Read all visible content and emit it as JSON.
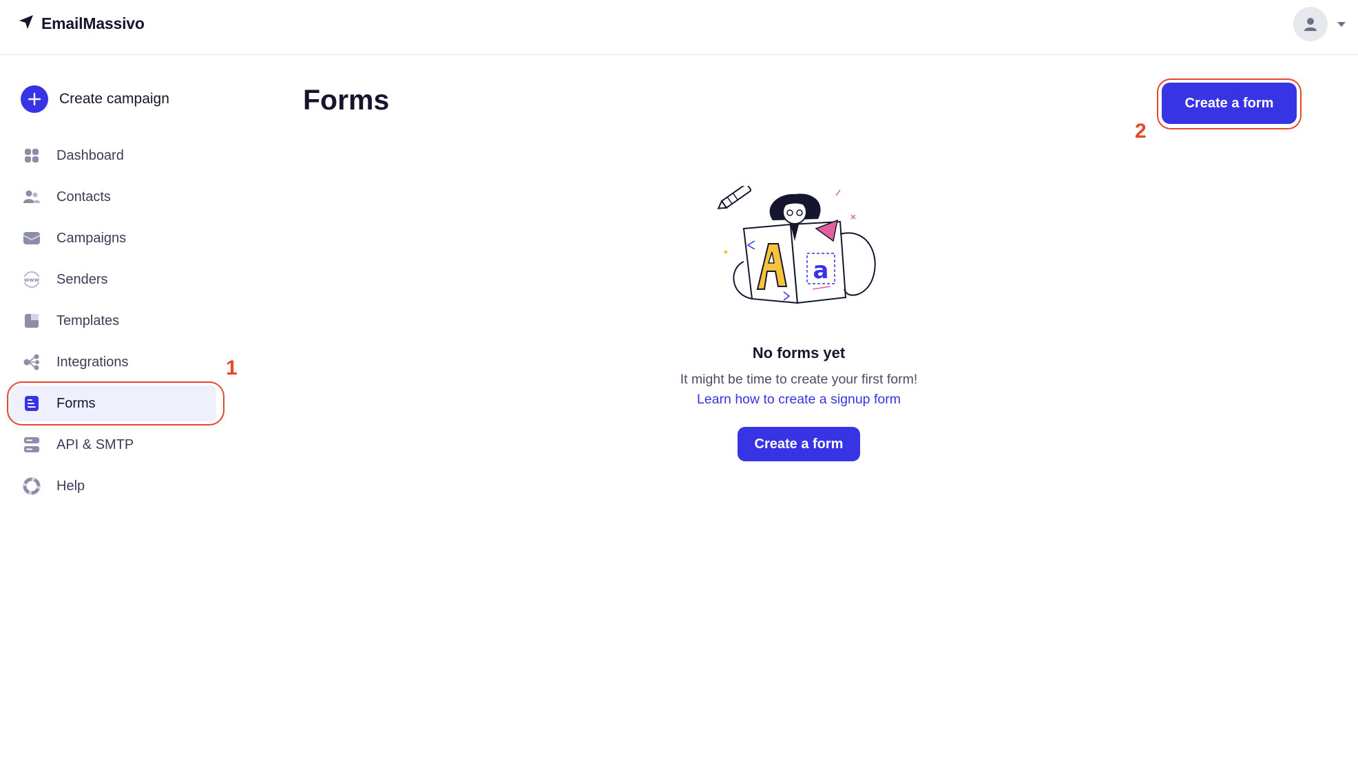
{
  "brand": {
    "name": "EmailMassivo",
    "icon": "paper-plane-icon"
  },
  "account": {
    "avatar_icon": "user-icon",
    "menu_icon": "caret-down-icon"
  },
  "sidebar": {
    "create_campaign": "Create campaign",
    "items": [
      {
        "label": "Dashboard",
        "icon": "dashboard-icon"
      },
      {
        "label": "Contacts",
        "icon": "contacts-icon"
      },
      {
        "label": "Campaigns",
        "icon": "campaigns-icon"
      },
      {
        "label": "Senders",
        "icon": "www-icon"
      },
      {
        "label": "Templates",
        "icon": "templates-icon"
      },
      {
        "label": "Integrations",
        "icon": "integrations-icon"
      },
      {
        "label": "Forms",
        "icon": "forms-icon",
        "active": true
      },
      {
        "label": "API & SMTP",
        "icon": "server-icon"
      },
      {
        "label": "Help",
        "icon": "lifebuoy-icon"
      }
    ]
  },
  "main": {
    "title": "Forms",
    "create_button": "Create a form",
    "empty_state": {
      "title": "No forms yet",
      "text": "It might be time to create your first form!",
      "link": "Learn how to create a signup form",
      "button": "Create a form"
    }
  },
  "annotations": {
    "step1": "1",
    "step2": "2",
    "color": "#e5472a"
  },
  "colors": {
    "accent": "#3734e6",
    "active_bg": "#eef0fb",
    "text": "#15162e"
  }
}
